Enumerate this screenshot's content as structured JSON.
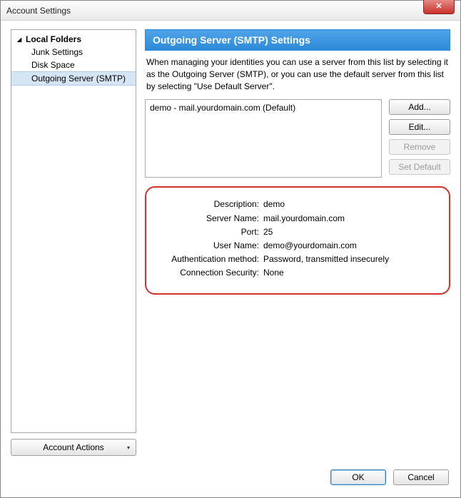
{
  "window": {
    "title": "Account Settings"
  },
  "closeGlyph": "✕",
  "sidebar": {
    "parent": "Local Folders",
    "items": [
      {
        "label": "Junk Settings",
        "selected": false
      },
      {
        "label": "Disk Space",
        "selected": false
      },
      {
        "label": "Outgoing Server (SMTP)",
        "selected": true
      }
    ],
    "accountActions": "Account Actions"
  },
  "main": {
    "header": "Outgoing Server (SMTP) Settings",
    "description": "When managing your identities you can use a server from this list by selecting it as the Outgoing Server (SMTP), or you can use the default server from this list by selecting \"Use Default Server\".",
    "servers": [
      "demo - mail.yourdomain.com (Default)"
    ],
    "buttons": {
      "add": "Add...",
      "edit": "Edit...",
      "remove": "Remove",
      "setDefault": "Set Default"
    },
    "details": {
      "descriptionLabel": "Description:",
      "descriptionValue": "demo",
      "serverNameLabel": "Server Name:",
      "serverNameValue": "mail.yourdomain.com",
      "portLabel": "Port:",
      "portValue": "25",
      "userNameLabel": "User Name:",
      "userNameValue": "demo@yourdomain.com",
      "authLabel": "Authentication method:",
      "authValue": "Password, transmitted insecurely",
      "connLabel": "Connection Security:",
      "connValue": "None"
    }
  },
  "footer": {
    "ok": "OK",
    "cancel": "Cancel"
  }
}
